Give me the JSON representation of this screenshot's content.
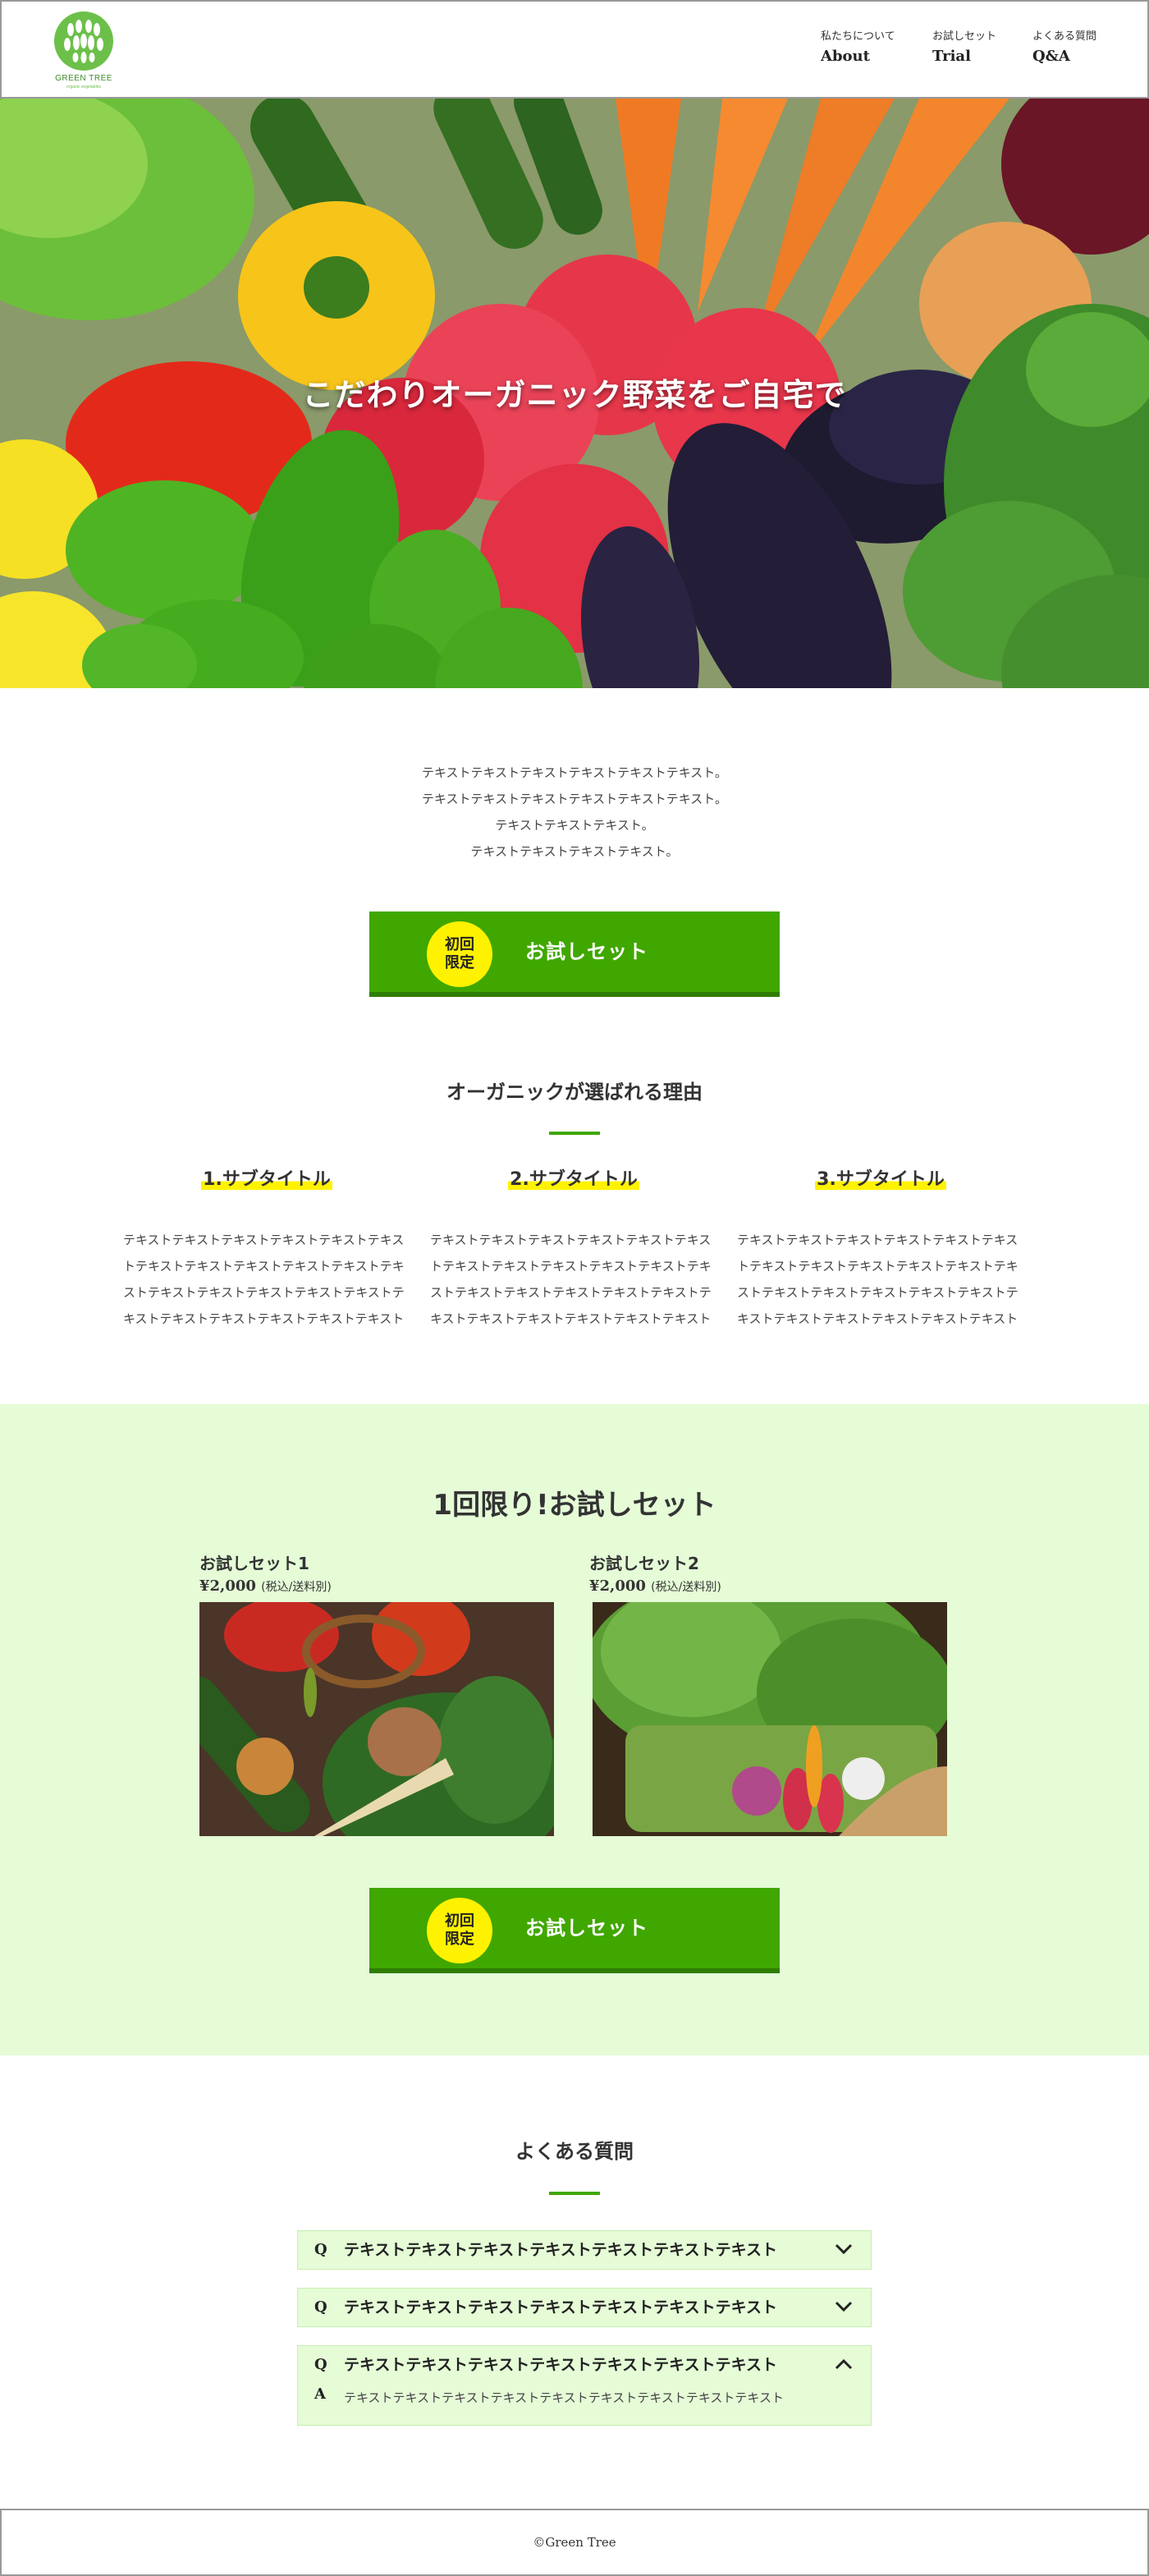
{
  "header": {
    "logo": {
      "name": "GREEN TREE",
      "tagline": "organic vegetables",
      "icon": "leaf-tree-logo"
    },
    "nav": [
      {
        "jp": "私たちについて",
        "en": "About"
      },
      {
        "jp": "お試しセット",
        "en": "Trial"
      },
      {
        "jp": "よくある質問",
        "en": "Q&A"
      }
    ]
  },
  "hero": {
    "headline": "こだわりオーガニック野菜をご自宅で"
  },
  "intro": {
    "lines": [
      "テキストテキストテキストテキストテキストテキスト。",
      "テキストテキストテキストテキストテキストテキスト。",
      "テキストテキストテキスト。",
      "テキストテキストテキストテキスト。"
    ]
  },
  "cta": {
    "badge_line1": "初回",
    "badge_line2": "限定",
    "label": "お試しセット"
  },
  "reasons": {
    "title": "オーガニックが選ばれる理由",
    "items": [
      {
        "title": "1.サブタイトル",
        "text": "テキストテキストテキストテキストテキストテキストテキストテキストテキストテキストテキストテキストテキストテキストテキストテキストテキストテキストテキストテキストテキストテキストテキストテキストテキストテキストテキストテキストテキストテキストテキストテキスト"
      },
      {
        "title": "2.サブタイトル",
        "text": "テキストテキストテキストテキストテキストテキストテキストテキストテキストテキストテキストテキストテキストテキストテキストテキストテキストテキストテキストテキストテキストテキストテキストテキストテキストテキストテキストテキストテキストテキストテキストテキスト"
      },
      {
        "title": "3.サブタイトル",
        "text": "テキストテキストテキストテキストテキストテキストテキストテキストテキストテキストテキストテキストテキストテキストテキストテキストテキストテキストテキストテキストテキストテキストテキストテキストテキストテキストテキストテキストテキストテキストテキストテキスト"
      }
    ]
  },
  "trial": {
    "title": "1回限り!お試しセット",
    "sets": [
      {
        "name": "お試しセット1",
        "price": "¥2,000",
        "note": "(税込/送料別)"
      },
      {
        "name": "お試しセット2",
        "price": "¥2,000",
        "note": "(税込/送料別)"
      }
    ]
  },
  "faq": {
    "title": "よくある質問",
    "items": [
      {
        "q_mark": "Q",
        "question": "テキストテキストテキストテキストテキストテキストテキスト",
        "expanded": false
      },
      {
        "q_mark": "Q",
        "question": "テキストテキストテキストテキストテキストテキストテキスト",
        "expanded": false
      },
      {
        "q_mark": "Q",
        "question": "テキストテキストテキストテキストテキストテキストテキスト",
        "expanded": true,
        "a_mark": "A",
        "answer": "テキストテキストテキストテキストテキストテキストテキストテキストテキスト"
      }
    ]
  },
  "footer": {
    "copyright": "©Green Tree"
  },
  "colors": {
    "accent": "#40a700",
    "accent_dark": "#2f7d00",
    "badge": "#fff200",
    "trial_bg": "#e5fcd7",
    "highlight": "#fff200"
  }
}
